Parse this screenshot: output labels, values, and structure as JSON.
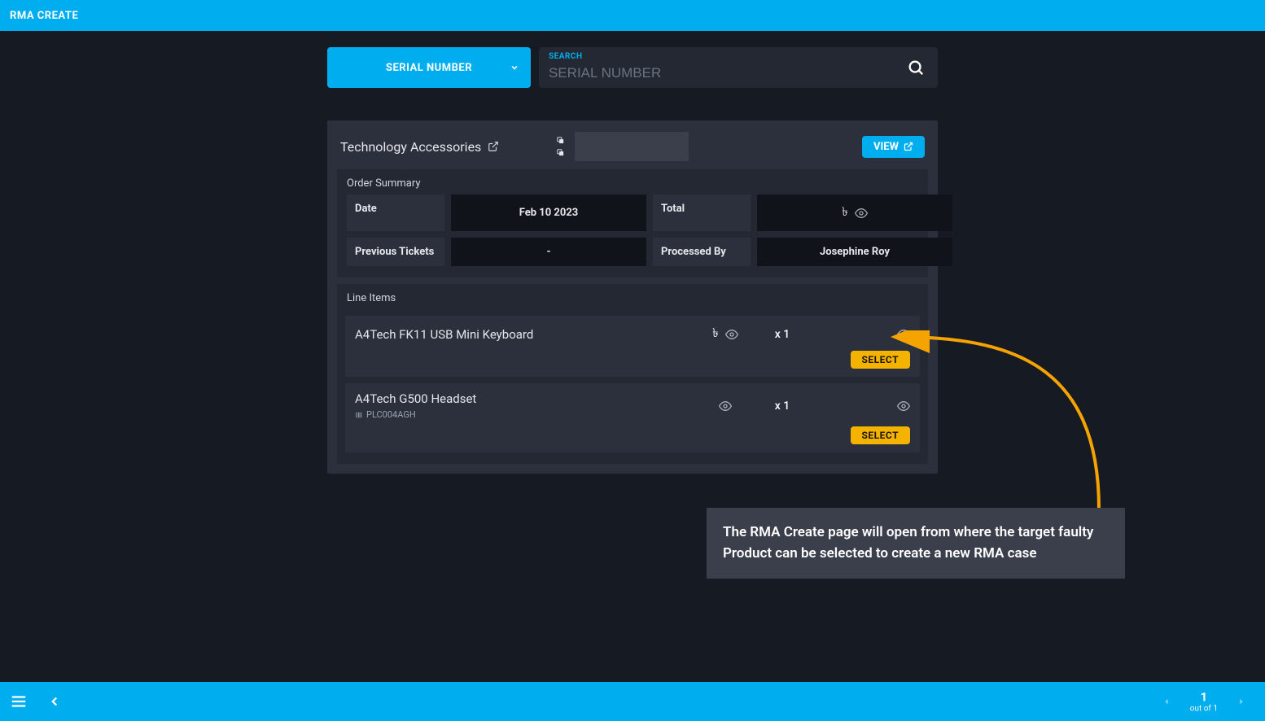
{
  "header": {
    "title": "RMA CREATE"
  },
  "search": {
    "dropdown_label": "SERIAL NUMBER",
    "field_label": "SEARCH",
    "placeholder": "SERIAL NUMBER",
    "value": ""
  },
  "order": {
    "company": "Technology Accessories",
    "view_label": "VIEW",
    "summary_title": "Order Summary",
    "summary": {
      "date_label": "Date",
      "date_value": "Feb 10 2023",
      "total_label": "Total",
      "prev_label": "Previous Tickets",
      "prev_value": "-",
      "processed_label": "Processed By",
      "processed_value": "Josephine Roy"
    },
    "line_title": "Line Items",
    "select_label": "SELECT",
    "items": [
      {
        "name": "A4Tech FK11 USB Mini Keyboard",
        "qty": "x 1",
        "serial": ""
      },
      {
        "name": "A4Tech G500 Headset",
        "qty": "x 1",
        "serial": "PLC004AGH"
      }
    ]
  },
  "tooltip": {
    "text": "The RMA Create page will open from where the target faulty Product can be selected to create a new RMA case"
  },
  "footer": {
    "page_num": "1",
    "page_sub": "out of 1"
  },
  "currency_symbol": "৳"
}
